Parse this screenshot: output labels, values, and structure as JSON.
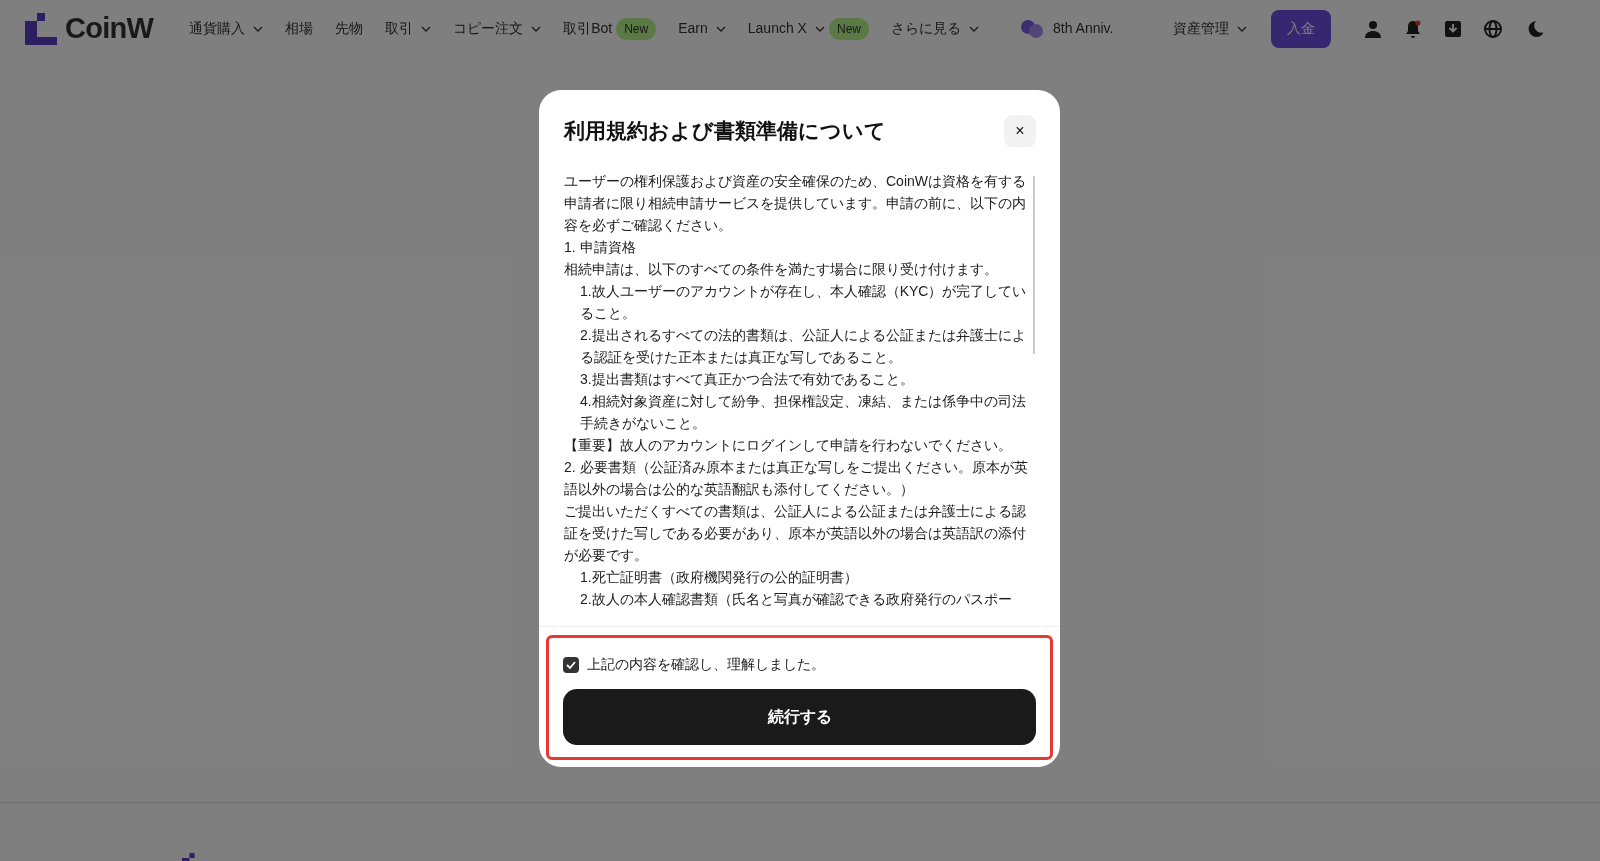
{
  "nav": {
    "logo": "CoinW",
    "items": [
      {
        "label": "通貨購入",
        "dropdown": true
      },
      {
        "label": "相場",
        "dropdown": false
      },
      {
        "label": "先物",
        "dropdown": false
      },
      {
        "label": "取引",
        "dropdown": true
      },
      {
        "label": "コピー注文",
        "dropdown": true
      },
      {
        "label": "取引Bot",
        "dropdown": false,
        "badge": "New"
      },
      {
        "label": "Earn",
        "dropdown": true
      },
      {
        "label": "Launch X",
        "dropdown": true,
        "badge": "New"
      },
      {
        "label": "さらに見る",
        "dropdown": true
      }
    ],
    "anniversary": "8th Anniv.",
    "assets": "資産管理",
    "deposit": "入金"
  },
  "modal": {
    "title": "利用規約および書類準備について",
    "close": "×",
    "paragraphs": [
      {
        "kind": "para",
        "text": "ユーザーの権利保護および資産の安全確保のため、CoinWは資格を有する申請者に限り相続申請サービスを提供しています。申請の前に、以下の内容を必ずご確認ください。"
      },
      {
        "kind": "para",
        "text": "1. 申請資格"
      },
      {
        "kind": "para",
        "text": "相続申請は、以下のすべての条件を満たす場合に限り受け付けます。"
      },
      {
        "kind": "indent",
        "text": "1.故人ユーザーのアカウントが存在し、本人確認（KYC）が完了していること。"
      },
      {
        "kind": "indent",
        "text": "2.提出されるすべての法的書類は、公証人による公証または弁護士による認証を受けた正本または真正な写しであること。"
      },
      {
        "kind": "indent",
        "text": "3.提出書類はすべて真正かつ合法で有効であること。"
      },
      {
        "kind": "indent",
        "text": "4.相続対象資産に対して紛争、担保権設定、凍結、または係争中の司法手続きがないこと。"
      },
      {
        "kind": "para",
        "text": "【重要】故人のアカウントにログインして申請を行わないでください。"
      },
      {
        "kind": "para",
        "text": "2. 必要書類（公証済み原本または真正な写しをご提出ください。原本が英語以外の場合は公的な英語翻訳も添付してください。）"
      },
      {
        "kind": "para",
        "text": "ご提出いただくすべての書類は、公証人による公証または弁護士による認証を受けた写しである必要があり、原本が英語以外の場合は英語訳の添付が必要です。"
      },
      {
        "kind": "indent",
        "text": "1.死亡証明書（政府機関発行の公的証明書）"
      },
      {
        "kind": "indent",
        "text": "2.故人の本人確認書類（氏名と写真が確認できる政府発行のパスポー"
      }
    ],
    "agree": {
      "label": "上記の内容を確認し、理解しました。",
      "checked": true
    },
    "button": "続行する"
  }
}
